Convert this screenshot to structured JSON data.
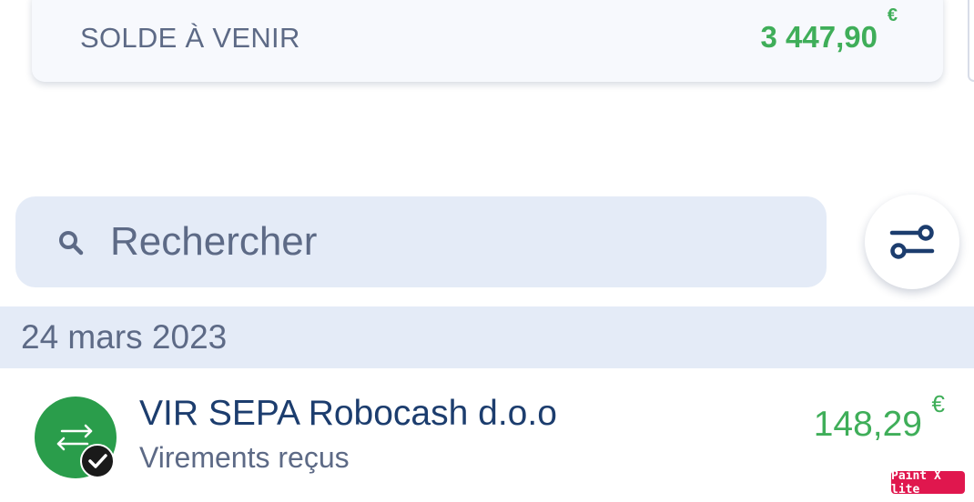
{
  "balance": {
    "label": "SOLDE À VENIR",
    "amount": "3 447,90",
    "currency": "€"
  },
  "search": {
    "placeholder": "Rechercher",
    "value": "",
    "icon": "search-icon"
  },
  "filter": {
    "icon": "sliders-icon"
  },
  "transactions": {
    "date": "24 mars 2023",
    "items": [
      {
        "title": "VIR SEPA Robocash d.o.o",
        "category": "Virements reçus",
        "amount": "148,29",
        "currency": "€",
        "icon": "transfer-arrows-icon",
        "status_icon": "checkmark-icon"
      }
    ]
  },
  "watermark": "Paint X lite",
  "colors": {
    "positive": "#3fae59",
    "accent_bg": "#e4ebf7",
    "primary_text": "#1c3d6e",
    "secondary_text": "#5d6a86",
    "avatar_green": "#2a9d4b"
  }
}
